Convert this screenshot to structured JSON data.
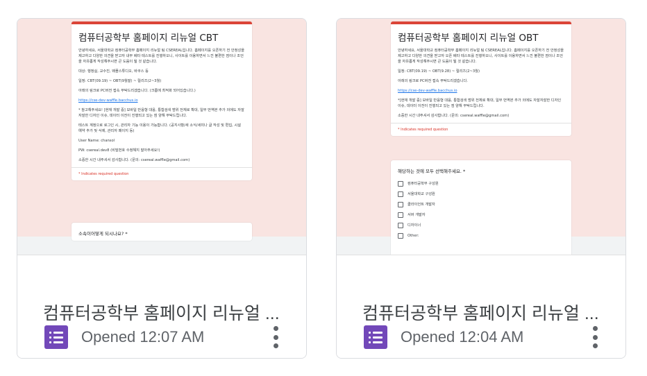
{
  "colors": {
    "forms_purple": "#7248b9",
    "form_accent": "#db4437",
    "thumb_bg": "#f9e4e1"
  },
  "cards": [
    {
      "form_title": "컴퓨터공학부 홈페이지 리뉴얼 CBT",
      "desc": [
        "안녕하세요, 서울대학교 컴퓨터공학부 홈페이지 리뉴얼 팀 CSEREAL입니다. 홈페이지를 오픈하기 전 안정성을 제고하고 다양한 의견을 받고자 내부 베타 테스트를 진행하오니, 사이트를 이용하면서 느낀 불편한 점이나 조언을 자유롭게 작성해주시면 큰 도움이 될 것 같습니다.",
        "대상: 행정실, 교수진, 왜플스튜디오, 바쿠스 등",
        "일정: CBT(09.19) ~ OBT(9월말) ~ 릴리즈(2~3월)",
        "아래의 링크로 PC버전 접속 부탁드리겠습니다. (크롬에 최적화 되어있습니다.)",
        "https://cse-dev-waffle.bacchus.io",
        "* 참고해주세요! [현재 개발 중] 모바일 반응형 대응, 통합검색 범위 전체로 확대, 일부 번역본 추가 외에도 자잘자잘한 디자인 이슈, 데이터 이전이 진행되고 있는 점 양해 부탁드립니다.",
        "테스트 계정으로 로그인 시, 관리자 기능 이용이 가능합니다. (공지사항/새 소식/세미나 글 작성 및 편집, 시설 예약 추가 및 삭제, 관리자 페이지 등)",
        "User Name: chansol",
        "PW: csereal.dev8 (비밀번호 수정해지 말아주세요!)",
        "소중한 시간 내주셔서 감사합니다. (문의: csereal.waffle@gmail.com)"
      ],
      "required_note": "* Indicates required question",
      "question": "소속이어떻게 되시나요? *",
      "options": [],
      "file_name": "컴퓨터공학부 홈페이지 리뉴얼 ...",
      "opened": "Opened 12:07 AM",
      "icon": "google-forms-icon",
      "more_icon": "more-vert-icon"
    },
    {
      "form_title": "컴퓨터공학부 홈페이지 리뉴얼 OBT",
      "desc": [
        "안녕하세요, 서울대학교 컴퓨터공학부 홈페이지 리뉴얼 팀 CSEREAL입니다. 홈페이지를 오픈하기 전 안정성을 제고하고 다양한 의견을 받고자 오픈 베타 테스트를 진행하오니, 사이트를 이용하면서 느낀 불편한 점이나 조언을 자유롭게 작성해주시면 큰 도움이 될 것 같습니다.",
        "일정: CBT(09.19) ~ OBT(9.28) ~ 릴리즈(2~3월)",
        "아래의 링크로 PC버전 접속 부탁드리겠습니다.",
        "https://cse-dev-waffle.bacchus.io",
        "*[현재 개발 중] 모바일 반응형 대응, 통합검색 범위 전체로 확대, 일부 번역본 추가 외에도 자잘자잘한 디자인 이슈, 데이터 이전이 진행되고 있는 점 양해 부탁드립니다.",
        "소중한 시간 내주셔서 감사합니다. (문의: csereal.waffle@gmail.com)"
      ],
      "required_note": "* Indicates required question",
      "question": "해당하는 것에 모두 선택해주세요. *",
      "options": [
        "컴퓨터공학부 구성원",
        "서울대학교 구성원",
        "클라이언트 개발자",
        "서버 개발자",
        "디자이너",
        "Other:"
      ],
      "file_name": "컴퓨터공학부 홈페이지 리뉴얼 ...",
      "opened": "Opened 12:04 AM",
      "icon": "google-forms-icon",
      "more_icon": "more-vert-icon"
    }
  ]
}
